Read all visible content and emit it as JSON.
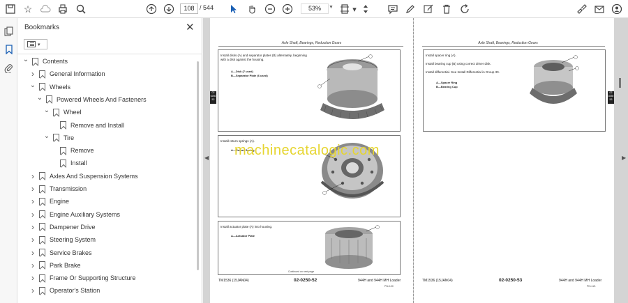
{
  "toolbar": {
    "page_current": "108",
    "page_total": "/ 544",
    "zoom": "53%"
  },
  "bookmarks": {
    "title": "Bookmarks",
    "items": [
      {
        "label": "Contents",
        "level": 0,
        "state": "open"
      },
      {
        "label": "General Information",
        "level": 1,
        "state": "closed"
      },
      {
        "label": "Wheels",
        "level": 1,
        "state": "open"
      },
      {
        "label": "Powered Wheels And Fasteners",
        "level": 2,
        "state": "open"
      },
      {
        "label": "Wheel",
        "level": 3,
        "state": "open"
      },
      {
        "label": "Remove and Install",
        "level": 4,
        "state": "leaf"
      },
      {
        "label": "Tire",
        "level": 3,
        "state": "open"
      },
      {
        "label": "Remove",
        "level": 4,
        "state": "leaf"
      },
      {
        "label": "Install",
        "level": 4,
        "state": "leaf"
      },
      {
        "label": "Axles And Suspension Systems",
        "level": 1,
        "state": "closed"
      },
      {
        "label": "Transmission",
        "level": 1,
        "state": "closed"
      },
      {
        "label": "Engine",
        "level": 1,
        "state": "closed"
      },
      {
        "label": "Engine Auxiliary Systems",
        "level": 1,
        "state": "closed"
      },
      {
        "label": "Dampener Drive",
        "level": 1,
        "state": "closed"
      },
      {
        "label": "Steering System",
        "level": 1,
        "state": "closed"
      },
      {
        "label": "Service Brakes",
        "level": 1,
        "state": "closed"
      },
      {
        "label": "Park Brake",
        "level": 1,
        "state": "closed"
      },
      {
        "label": "Frame Or Supporting Structure",
        "level": 1,
        "state": "closed"
      },
      {
        "label": "Operator's Station",
        "level": 1,
        "state": "closed"
      }
    ]
  },
  "document": {
    "watermark": "machinecatalogic.com",
    "left_page": {
      "header": "Axle Shaft, Bearings, Reduction Gears",
      "tab": "02 0250 52",
      "sections": [
        {
          "text": "Install disks (A) and separator plates (B) alternately, beginning with a disk against the housing.",
          "legend": "A—Disk (7 used)\nB—Separator Plate (6 used)"
        },
        {
          "text": "Install return springs (A).",
          "legend": "A—Return Spring"
        },
        {
          "text": "Install actuator plate (A) into housing.",
          "legend": "A—Actuator Plate",
          "note": "Continued on next page"
        }
      ],
      "footer_left": "TM1536 (15JAN04)",
      "footer_center": "02-0250-52",
      "footer_right": "944H and 944H MH Loader",
      "footer_sub": "PN=120"
    },
    "right_page": {
      "header": "Axle Shaft, Bearings, Reduction Gears",
      "tab": "02 0250 53",
      "sections": [
        {
          "text": "Install spacer ring (A).\n\nInstall bearing cup (B) using correct driver disk.\n\nInstall differential. See Install Differential in Group 30.",
          "legend": "A—Spacer Ring\nB—Bearing Cup"
        }
      ],
      "footer_left": "TM1536 (15JAN04)",
      "footer_center": "02-0250-53",
      "footer_right": "944H and 944H MH Loader",
      "footer_sub": "PN=121"
    }
  },
  "colors": {
    "viewer_bg": "#d4d4d4",
    "watermark": "#e6d530"
  }
}
